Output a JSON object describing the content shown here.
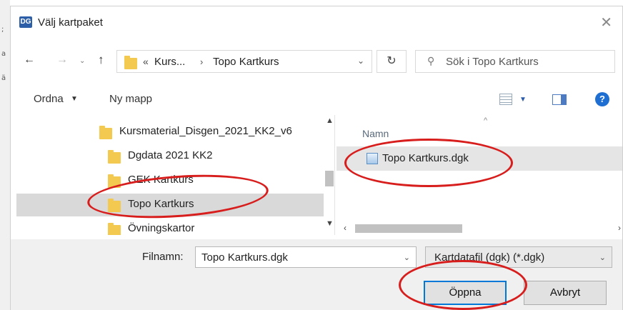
{
  "background": {
    "edge_marks": [
      ";",
      "a",
      "ä"
    ]
  },
  "window": {
    "title": "Välj kartpaket",
    "app_icon_text": "DG"
  },
  "nav": {
    "address_chevron": "«",
    "breadcrumb": [
      "Kurs...",
      "Topo Kartkurs"
    ],
    "breadcrumb_separator": "›",
    "search_placeholder": "Sök i Topo Kartkurs"
  },
  "toolbar": {
    "organize_label": "Ordna",
    "new_folder_label": "Ny mapp",
    "help_label": "?"
  },
  "tree": {
    "items": [
      {
        "label": "Kursmaterial_Disgen_2021_KK2_v6",
        "selected": false
      },
      {
        "label": "Dgdata 2021 KK2",
        "selected": false
      },
      {
        "label": "GEK Kartkurs",
        "selected": false
      },
      {
        "label": "Topo Kartkurs",
        "selected": true
      },
      {
        "label": "Övningskartor",
        "selected": false
      }
    ]
  },
  "filelist": {
    "column_name": "Namn",
    "files": [
      {
        "label": "Topo Kartkurs.dgk",
        "selected": true
      }
    ]
  },
  "footer": {
    "filename_label": "Filnamn:",
    "filename_value": "Topo Kartkurs.dgk",
    "filter_value": "Kartdatafil (dgk) (*.dgk)",
    "open_label": "Öppna",
    "cancel_label": "Avbryt"
  },
  "colors": {
    "annotation": "#d81d1d",
    "selection": "#d9d9d9",
    "folder": "#f3c94f",
    "accent": "#0078d7"
  }
}
